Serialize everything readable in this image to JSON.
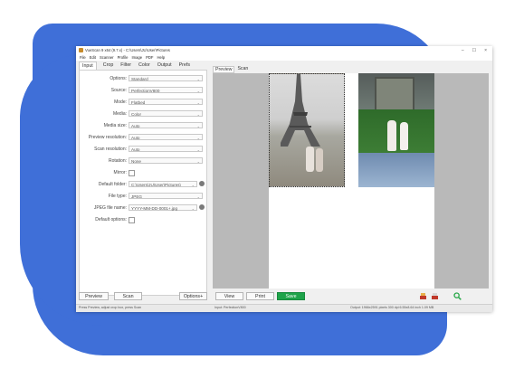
{
  "window": {
    "title": "VueScan 9 x64 (9.7.x) - C:\\Users\\JU\\User\\Pictures",
    "controls": {
      "minimize": "–",
      "maximize": "☐",
      "close": "×"
    }
  },
  "menu": [
    "File",
    "Edit",
    "Scanner",
    "Profile",
    "Image",
    "PDF",
    "Help"
  ],
  "left_tabs": [
    "Input",
    "Crop",
    "Filter",
    "Color",
    "Output",
    "Prefs"
  ],
  "settings": [
    {
      "label": "Options:",
      "value": "Standard",
      "type": "select"
    },
    {
      "label": "Source:",
      "value": "PerfectionV800",
      "type": "select"
    },
    {
      "label": "Mode:",
      "value": "Flatbed",
      "type": "select"
    },
    {
      "label": "Media:",
      "value": "Color",
      "type": "select"
    },
    {
      "label": "Media size:",
      "value": "Auto",
      "type": "select"
    },
    {
      "label": "Preview resolution:",
      "value": "Auto",
      "type": "select"
    },
    {
      "label": "Scan resolution:",
      "value": "Auto",
      "type": "select"
    },
    {
      "label": "Rotation:",
      "value": "None",
      "type": "select"
    },
    {
      "label": "Mirror:",
      "value": "",
      "type": "checkbox"
    },
    {
      "label": "Default folder:",
      "value": "C:\\Users\\JU\\User\\Pictures\\",
      "type": "folder"
    },
    {
      "label": "File type:",
      "value": "JPEG",
      "type": "select"
    },
    {
      "label": "JPEG file name:",
      "value": "YYYY-MM-DD-0001+.jpg",
      "type": "folder"
    },
    {
      "label": "Default options:",
      "value": "",
      "type": "checkbox"
    }
  ],
  "right_tabs": [
    "Preview",
    "Scan"
  ],
  "buttons": {
    "preview": "Preview",
    "scan": "Scan",
    "options": "Options+",
    "view": "View",
    "print": "Print",
    "save": "Save"
  },
  "icons": [
    "scanner-icon",
    "scanner-red-icon",
    "zoom-icon"
  ],
  "status": {
    "left": "Press Preview, adjust crop box, press Scan",
    "middle": "Input: PerfectionV800",
    "right": "Output: 1966x2591 pixels 300 dpi 6.55x8.64 inch 1.09 MB"
  },
  "colors": {
    "background_blob": "#3f6fd8",
    "save_button": "#1fa34a"
  }
}
